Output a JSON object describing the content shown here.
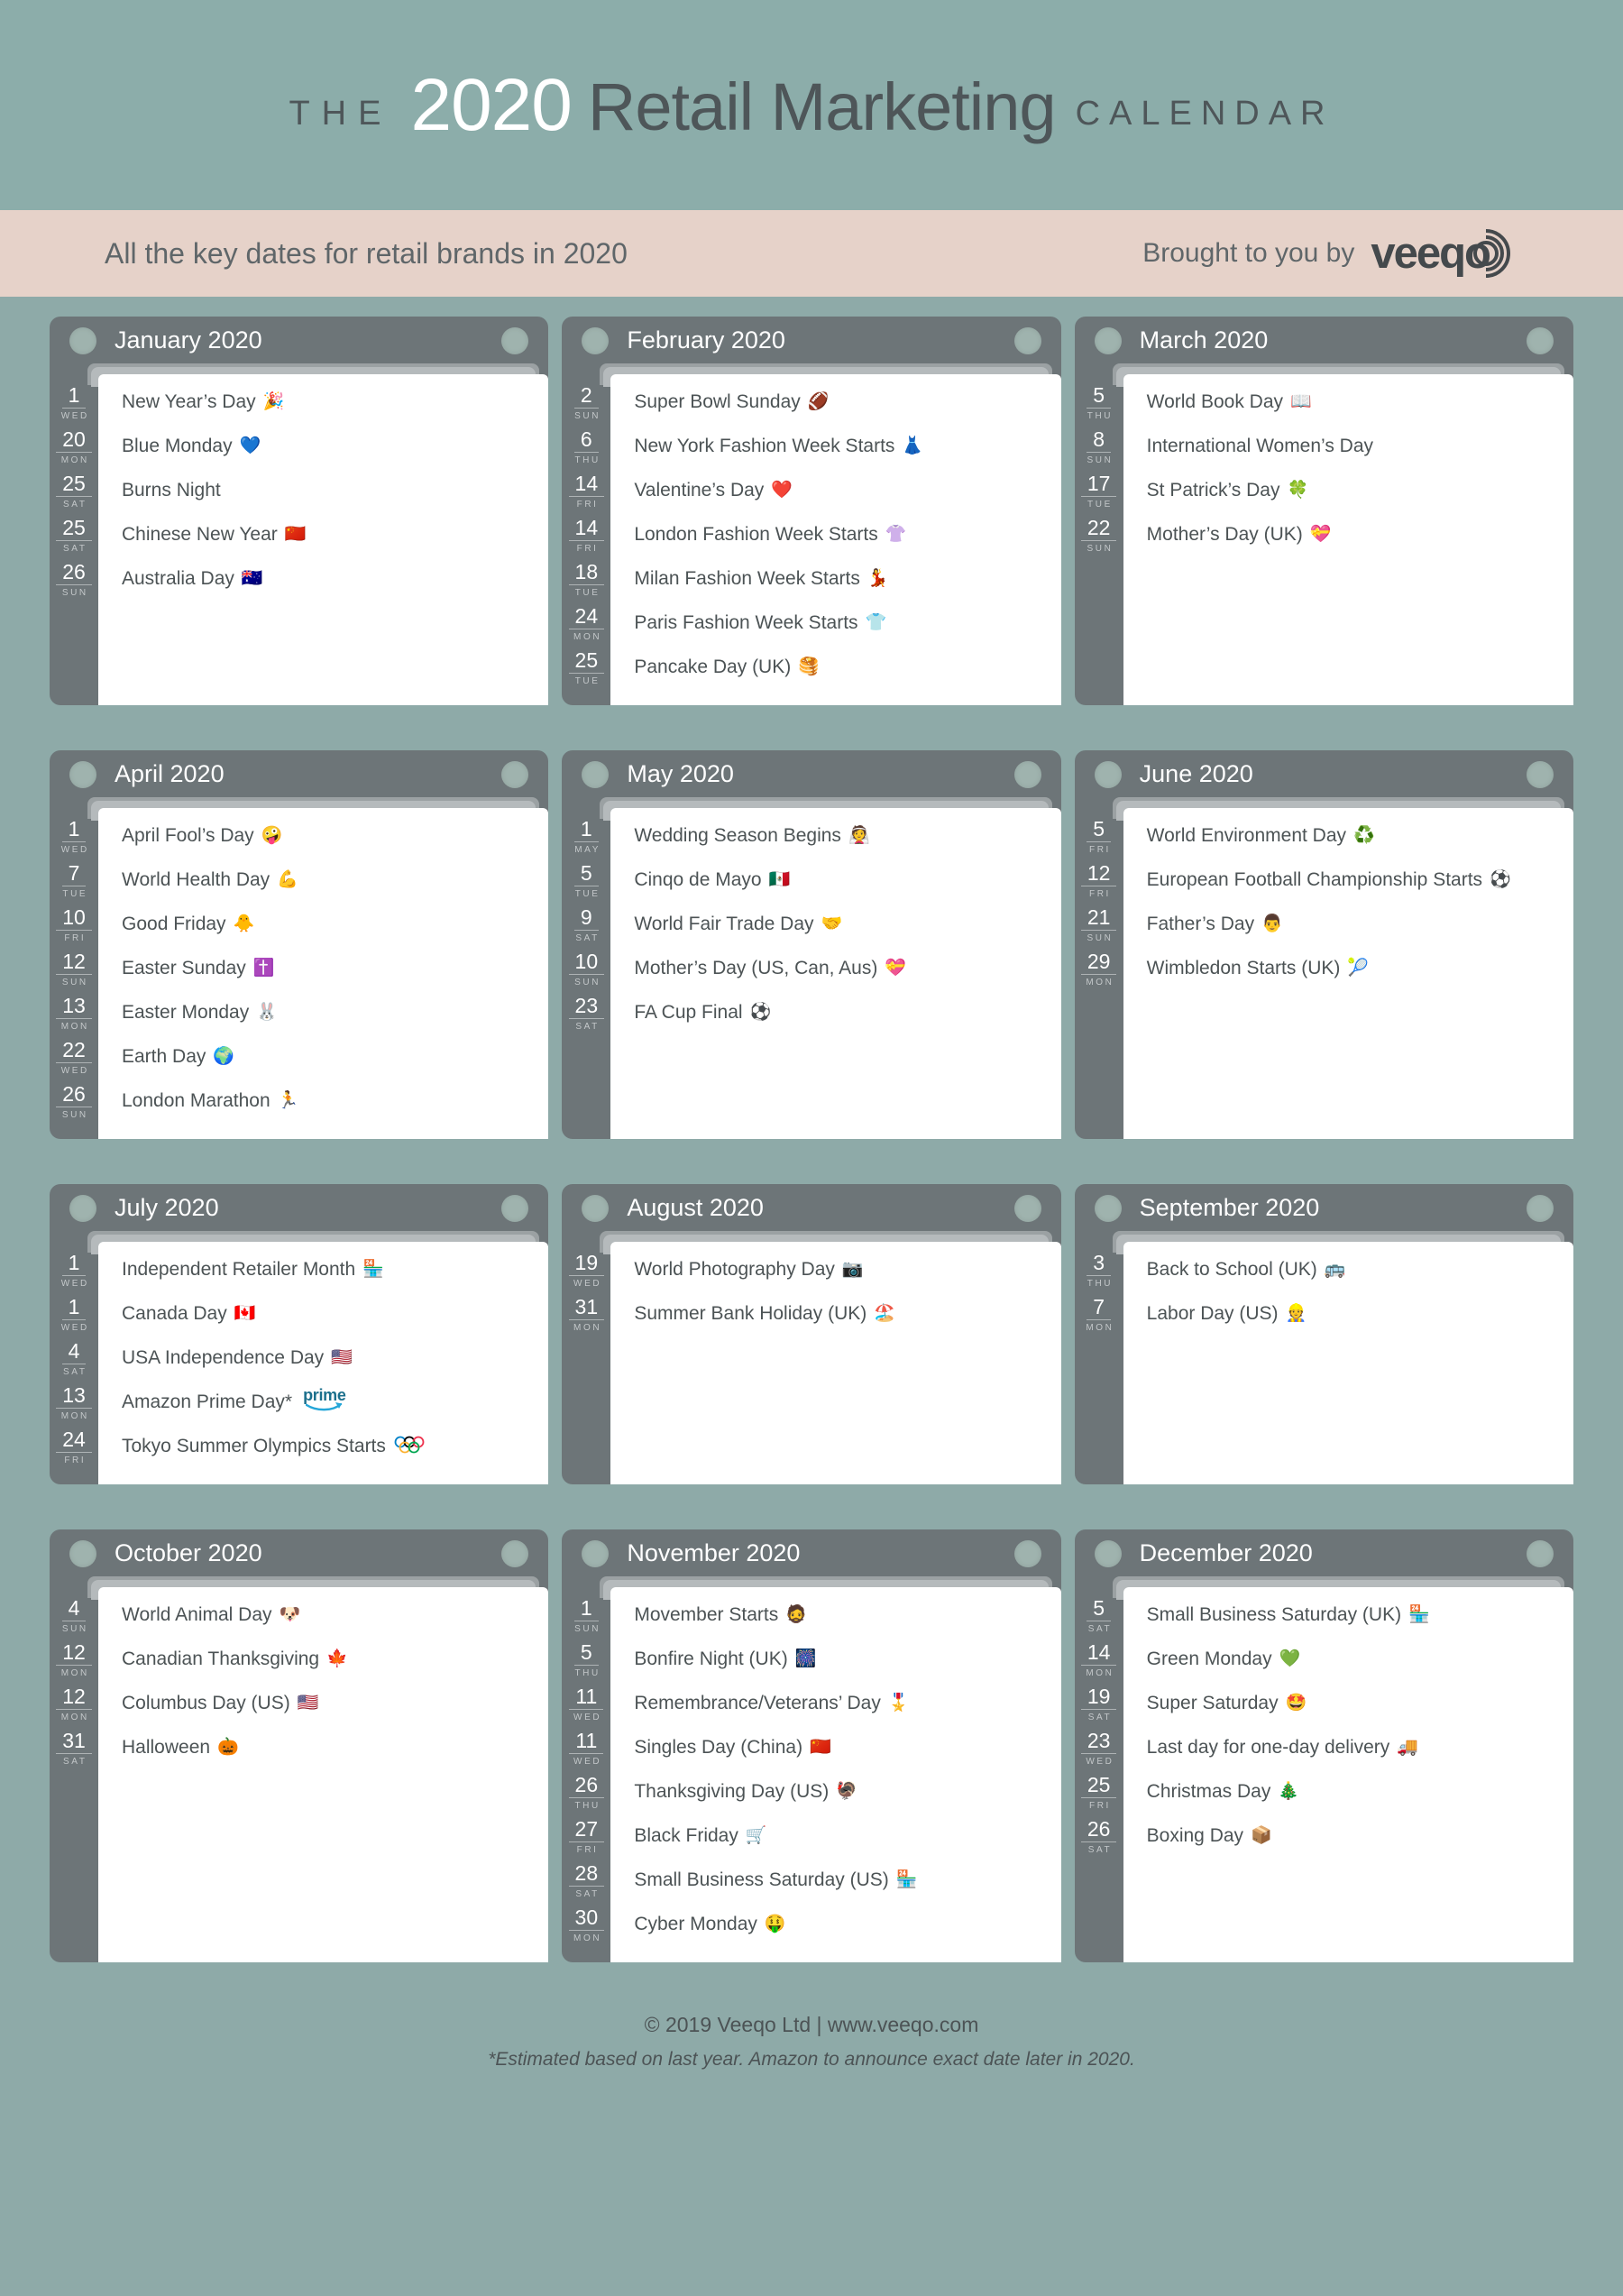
{
  "header": {
    "the": "THE",
    "year": "2020",
    "title": "Retail Marketing",
    "calendar": "CALENDAR"
  },
  "subbar": {
    "tagline": "All the key dates for retail brands in 2020",
    "brought_by": "Brought to you by",
    "brand": "veeqo"
  },
  "colors": {
    "page_background": "#8eaaa8",
    "masthead": "#8cadaa",
    "subbar": "#e6d2c9",
    "card_header": "#6d7578",
    "sheet": "#ffffff",
    "accent_text": "#4c5355"
  },
  "months": [
    {
      "title": "January 2020",
      "events": [
        {
          "day": "1",
          "weekday": "WED",
          "label": "New Year’s Day",
          "emoji": "🎉"
        },
        {
          "day": "20",
          "weekday": "MON",
          "label": "Blue Monday",
          "emoji": "💙"
        },
        {
          "day": "25",
          "weekday": "SAT",
          "label": "Burns Night",
          "emoji": ""
        },
        {
          "day": "25",
          "weekday": "SAT",
          "label": "Chinese New Year",
          "emoji": "🇨🇳"
        },
        {
          "day": "26",
          "weekday": "SUN",
          "label": "Australia Day",
          "emoji": "🇦🇺"
        }
      ]
    },
    {
      "title": "February 2020",
      "events": [
        {
          "day": "2",
          "weekday": "SUN",
          "label": "Super Bowl Sunday",
          "emoji": "🏈"
        },
        {
          "day": "6",
          "weekday": "THU",
          "label": "New York Fashion Week Starts",
          "emoji": "👗"
        },
        {
          "day": "14",
          "weekday": "FRI",
          "label": "Valentine’s Day",
          "emoji": "❤️"
        },
        {
          "day": "14",
          "weekday": "FRI",
          "label": "London Fashion Week Starts",
          "emoji": "👚"
        },
        {
          "day": "18",
          "weekday": "TUE",
          "label": "Milan Fashion Week Starts",
          "emoji": "💃"
        },
        {
          "day": "24",
          "weekday": "MON",
          "label": "Paris Fashion Week Starts",
          "emoji": "👕"
        },
        {
          "day": "25",
          "weekday": "TUE",
          "label": "Pancake Day (UK)",
          "emoji": "🥞"
        }
      ]
    },
    {
      "title": "March 2020",
      "events": [
        {
          "day": "5",
          "weekday": "THU",
          "label": "World Book Day",
          "emoji": "📖"
        },
        {
          "day": "8",
          "weekday": "SUN",
          "label": "International Women’s Day",
          "emoji": ""
        },
        {
          "day": "17",
          "weekday": "TUE",
          "label": "St Patrick’s Day",
          "emoji": "🍀"
        },
        {
          "day": "22",
          "weekday": "SUN",
          "label": "Mother’s Day (UK)",
          "emoji": "💝"
        }
      ]
    },
    {
      "title": "April 2020",
      "events": [
        {
          "day": "1",
          "weekday": "WED",
          "label": "April Fool’s Day",
          "emoji": "🤪"
        },
        {
          "day": "7",
          "weekday": "TUE",
          "label": "World Health Day",
          "emoji": "💪"
        },
        {
          "day": "10",
          "weekday": "FRI",
          "label": "Good Friday",
          "emoji": "🐥"
        },
        {
          "day": "12",
          "weekday": "SUN",
          "label": "Easter Sunday",
          "emoji": "✝️"
        },
        {
          "day": "13",
          "weekday": "MON",
          "label": "Easter Monday",
          "emoji": "🐰"
        },
        {
          "day": "22",
          "weekday": "WED",
          "label": "Earth Day",
          "emoji": "🌍"
        },
        {
          "day": "26",
          "weekday": "SUN",
          "label": "London Marathon",
          "emoji": "🏃"
        }
      ]
    },
    {
      "title": "May 2020",
      "events": [
        {
          "day": "1",
          "weekday": "MAY",
          "label": "Wedding Season Begins",
          "emoji": "👰"
        },
        {
          "day": "5",
          "weekday": "TUE",
          "label": "Cinqo de Mayo",
          "emoji": "🇲🇽"
        },
        {
          "day": "9",
          "weekday": "SAT",
          "label": "World Fair Trade Day",
          "emoji": "🤝"
        },
        {
          "day": "10",
          "weekday": "SUN",
          "label": "Mother’s Day (US, Can, Aus)",
          "emoji": "💝"
        },
        {
          "day": "23",
          "weekday": "SAT",
          "label": "FA Cup Final",
          "emoji": "⚽"
        }
      ]
    },
    {
      "title": "June 2020",
      "events": [
        {
          "day": "5",
          "weekday": "FRI",
          "label": "World Environment Day",
          "emoji": "♻️"
        },
        {
          "day": "12",
          "weekday": "FRI",
          "label": "European Football Championship Starts",
          "emoji": "⚽"
        },
        {
          "day": "21",
          "weekday": "SUN",
          "label": "Father’s Day",
          "emoji": "👨"
        },
        {
          "day": "29",
          "weekday": "MON",
          "label": "Wimbledon Starts (UK)",
          "emoji": "🎾"
        }
      ]
    },
    {
      "title": "July 2020",
      "events": [
        {
          "day": "1",
          "weekday": "WED",
          "label": "Independent Retailer Month",
          "emoji": "🏪"
        },
        {
          "day": "1",
          "weekday": "WED",
          "label": "Canada Day",
          "emoji": "🇨🇦"
        },
        {
          "day": "4",
          "weekday": "SAT",
          "label": "USA Independence Day",
          "emoji": "🇺🇸"
        },
        {
          "day": "13",
          "weekday": "MON",
          "label": "Amazon Prime Day*",
          "emoji": "",
          "logo": "prime"
        },
        {
          "day": "24",
          "weekday": "FRI",
          "label": "Tokyo Summer Olympics Starts",
          "emoji": "",
          "logo": "olympics"
        }
      ]
    },
    {
      "title": "August 2020",
      "events": [
        {
          "day": "19",
          "weekday": "WED",
          "label": "World Photography Day",
          "emoji": "📷"
        },
        {
          "day": "31",
          "weekday": "MON",
          "label": "Summer Bank Holiday (UK)",
          "emoji": "🏖️"
        }
      ]
    },
    {
      "title": "September 2020",
      "events": [
        {
          "day": "3",
          "weekday": "THU",
          "label": "Back to School (UK)",
          "emoji": "🚌"
        },
        {
          "day": "7",
          "weekday": "MON",
          "label": "Labor Day (US)",
          "emoji": "👷"
        }
      ]
    },
    {
      "title": "October 2020",
      "events": [
        {
          "day": "4",
          "weekday": "SUN",
          "label": "World Animal Day",
          "emoji": "🐶"
        },
        {
          "day": "12",
          "weekday": "MON",
          "label": "Canadian Thanksgiving",
          "emoji": "🍁"
        },
        {
          "day": "12",
          "weekday": "MON",
          "label": "Columbus Day (US)",
          "emoji": "🇺🇸"
        },
        {
          "day": "31",
          "weekday": "SAT",
          "label": "Halloween",
          "emoji": "🎃"
        }
      ]
    },
    {
      "title": "November 2020",
      "events": [
        {
          "day": "1",
          "weekday": "SUN",
          "label": "Movember Starts",
          "emoji": "🧔"
        },
        {
          "day": "5",
          "weekday": "THU",
          "label": "Bonfire Night (UK)",
          "emoji": "🎆"
        },
        {
          "day": "11",
          "weekday": "WED",
          "label": "Remembrance/Veterans’ Day",
          "emoji": "🎖️"
        },
        {
          "day": "11",
          "weekday": "WED",
          "label": "Singles Day (China)",
          "emoji": "🇨🇳"
        },
        {
          "day": "26",
          "weekday": "THU",
          "label": "Thanksgiving Day (US)",
          "emoji": "🦃"
        },
        {
          "day": "27",
          "weekday": "FRI",
          "label": "Black Friday",
          "emoji": "🛒"
        },
        {
          "day": "28",
          "weekday": "SAT",
          "label": "Small Business Saturday (US)",
          "emoji": "🏪"
        },
        {
          "day": "30",
          "weekday": "MON",
          "label": "Cyber Monday",
          "emoji": "🤑"
        }
      ]
    },
    {
      "title": "December 2020",
      "events": [
        {
          "day": "5",
          "weekday": "SAT",
          "label": "Small Business Saturday (UK)",
          "emoji": "🏪"
        },
        {
          "day": "14",
          "weekday": "MON",
          "label": "Green Monday",
          "emoji": "💚"
        },
        {
          "day": "19",
          "weekday": "SAT",
          "label": "Super Saturday",
          "emoji": "🤩"
        },
        {
          "day": "23",
          "weekday": "WED",
          "label": "Last day for one-day delivery",
          "emoji": "🚚"
        },
        {
          "day": "25",
          "weekday": "FRI",
          "label": "Christmas Day",
          "emoji": "🎄"
        },
        {
          "day": "26",
          "weekday": "SAT",
          "label": "Boxing Day",
          "emoji": "📦"
        }
      ]
    }
  ],
  "footer": {
    "copyright": "© 2019 Veeqo Ltd  |  www.veeqo.com",
    "disclaimer": "*Estimated based on last year. Amazon to announce exact date later in 2020."
  }
}
